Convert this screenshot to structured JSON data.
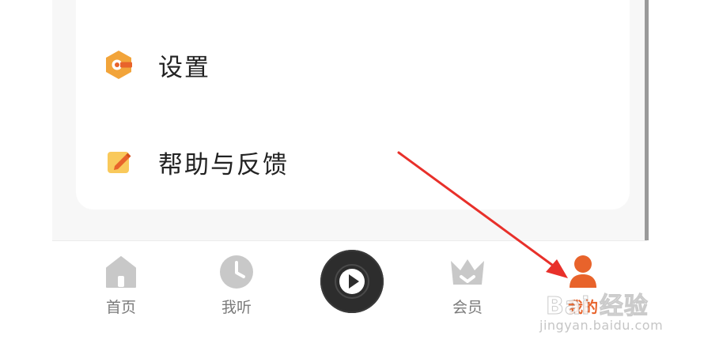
{
  "menu": {
    "items": [
      {
        "label": "设置",
        "icon": "settings-hex-icon"
      },
      {
        "label": "帮助与反馈",
        "icon": "edit-note-icon"
      }
    ]
  },
  "tabbar": {
    "tabs": [
      {
        "label": "首页",
        "icon": "home-icon",
        "active": false
      },
      {
        "label": "我听",
        "icon": "clock-icon",
        "active": false
      },
      {
        "label": "",
        "icon": "play-icon",
        "active": false
      },
      {
        "label": "会员",
        "icon": "crown-icon",
        "active": false
      },
      {
        "label": "我的",
        "icon": "user-icon",
        "active": true
      }
    ]
  },
  "colors": {
    "accent": "#e8632b",
    "icon_orange": "#f2a43a",
    "tab_inactive": "#c8c8c8",
    "arrow": "#e8302a"
  },
  "watermark": {
    "brand": "Bai 经验",
    "site": "jingyan.baidu.com"
  }
}
